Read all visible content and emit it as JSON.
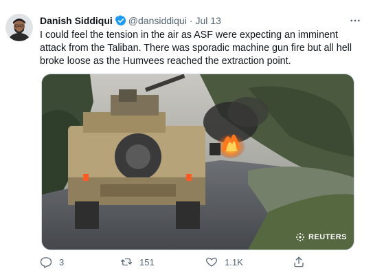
{
  "tweet": {
    "author_name": "Danish Siddiqui",
    "handle": "@dansiddiqui",
    "separator": "·",
    "date": "Jul 13",
    "text": "I could feel the tension in the air as ASF were expecting an imminent attack from the Taliban. There was sporadic machine gun fire but all hell broke loose as the Humvees reached the extraction point.",
    "media_credit": "REUTERS",
    "stats": {
      "replies": "3",
      "retweets": "151",
      "likes": "1.1K"
    }
  },
  "icons": {
    "verified": "verified-badge-icon",
    "more": "more-options-icon",
    "reply": "reply-icon",
    "retweet": "retweet-icon",
    "like": "heart-icon",
    "share": "share-icon",
    "credit_logo": "reuters-logo"
  },
  "colors": {
    "verified": "#1d9bf0",
    "text_primary": "#0f1419",
    "text_secondary": "#536471",
    "border": "#cfd9de"
  }
}
